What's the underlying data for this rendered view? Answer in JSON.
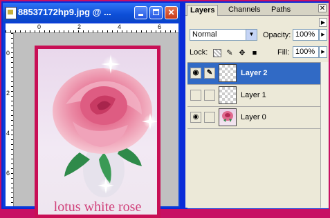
{
  "document": {
    "title": "88537172hp9.jpg @ ...",
    "ruler_top_labels": [
      "0",
      "2",
      "4",
      "6"
    ],
    "ruler_left_labels": [
      "0",
      "2",
      "4",
      "6"
    ],
    "caption": "lotus white rose"
  },
  "panel": {
    "tabs": [
      "Layers",
      "Channels",
      "Paths"
    ],
    "active_tab": "Layers",
    "blend_mode": "Normal",
    "opacity_label": "Opacity:",
    "opacity_value": "100%",
    "lock_label": "Lock:",
    "fill_label": "Fill:",
    "fill_value": "100%",
    "layers": [
      {
        "name": "Layer 2",
        "visible": true,
        "selected": true,
        "thumb": "transparent"
      },
      {
        "name": "Layer 1",
        "visible": false,
        "selected": false,
        "thumb": "transparent"
      },
      {
        "name": "Layer 0",
        "visible": true,
        "selected": false,
        "thumb": "rose"
      }
    ]
  },
  "colors": {
    "frame": "#c70f63",
    "titlebar": "#0d4fd8",
    "selected_layer": "#316ac5",
    "photo_border": "#c80f55",
    "caption": "#d0407a"
  }
}
